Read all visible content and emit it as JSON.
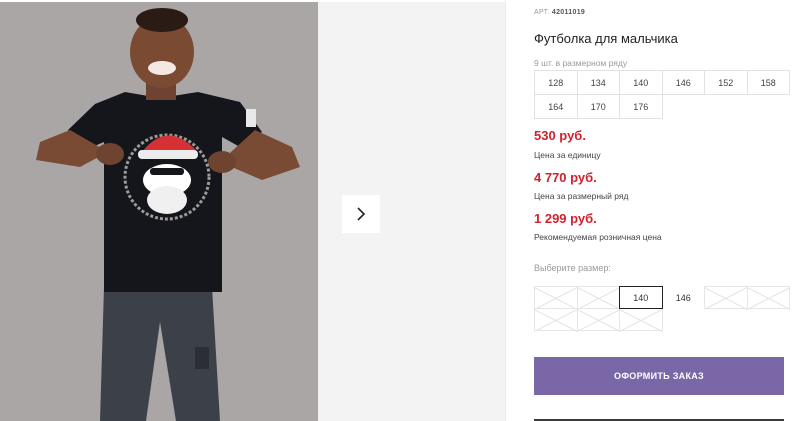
{
  "product": {
    "article_prefix": "АРТ.",
    "article_number": "42011019",
    "title": "Футболка для мальчика",
    "size_range_label": "9 шт. в размерном ряду",
    "size_range": [
      "128",
      "134",
      "140",
      "146",
      "152",
      "158",
      "164",
      "170",
      "176"
    ]
  },
  "prices": [
    {
      "value": "530 руб.",
      "caption": "Цена за единицу"
    },
    {
      "value": "4 770 руб.",
      "caption": "Цена за размерный ряд"
    },
    {
      "value": "1 299 руб.",
      "caption": "Рекомендуемая розничная цена"
    }
  ],
  "size_picker": {
    "label": "Выберите размер:",
    "options": [
      {
        "label": "",
        "state": "disabled"
      },
      {
        "label": "",
        "state": "disabled"
      },
      {
        "label": "140",
        "state": "selected"
      },
      {
        "label": "146",
        "state": "available"
      },
      {
        "label": "",
        "state": "disabled"
      },
      {
        "label": "",
        "state": "disabled"
      },
      {
        "label": "",
        "state": "disabled"
      },
      {
        "label": "",
        "state": "disabled"
      },
      {
        "label": "",
        "state": "disabled"
      }
    ]
  },
  "order_button": {
    "label": "ОФОРМИТЬ ЗАКАЗ"
  },
  "colors": {
    "price_red": "#d31f2e",
    "button_purple": "#7a67a8",
    "photo_background": "#a7a4a3"
  },
  "icons": {
    "gallery_next": "chevron-right-icon"
  }
}
